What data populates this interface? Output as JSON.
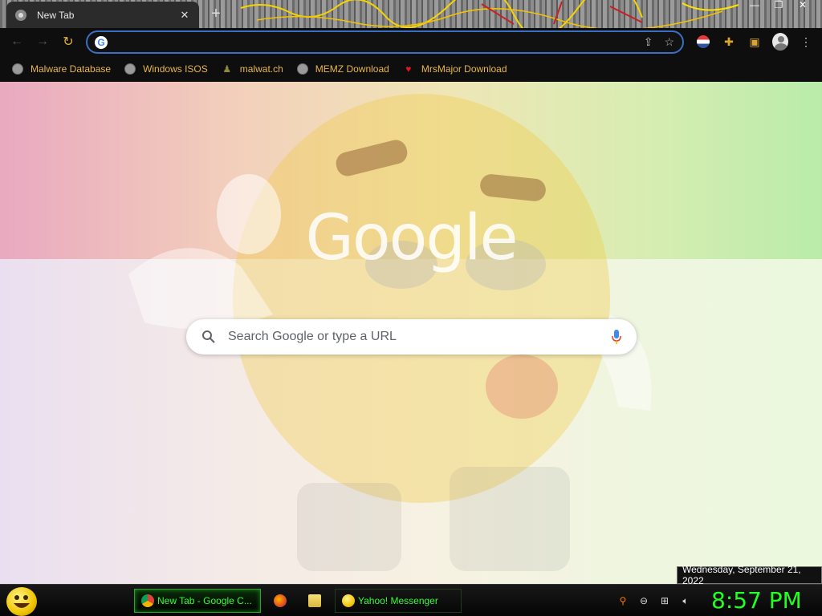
{
  "browser": {
    "tab": {
      "title": "New Tab",
      "close_glyph": "✕"
    },
    "new_tab_glyph": "+",
    "window_controls": [
      "—",
      "❐",
      "✕"
    ],
    "omnibox": {
      "value": "",
      "placeholder": ""
    }
  },
  "bookmarks": [
    {
      "label": "Malware Database",
      "icon": "globe-icon"
    },
    {
      "label": "Windows ISOS",
      "icon": "globe-icon"
    },
    {
      "label": "malwat.ch",
      "icon": "person-icon"
    },
    {
      "label": "MEMZ Download",
      "icon": "globe-icon"
    },
    {
      "label": "MrsMajor Download",
      "icon": "heart-icon"
    }
  ],
  "ntp": {
    "logo_text": "Google",
    "search_placeholder": "Search Google or type a URL"
  },
  "taskbar": {
    "buttons": [
      {
        "label": "New Tab - Google C...",
        "active": true
      },
      {
        "label": "",
        "active": false
      },
      {
        "label": "",
        "active": false
      },
      {
        "label": "Yahoo! Messenger",
        "active": false
      }
    ],
    "clock": "8:57 PM",
    "date_tooltip": "Wednesday, September 21, 2022"
  },
  "colors": {
    "bookmark_text": "#e7b64b",
    "clock": "#22ff22",
    "omnibox_border": "#3b6fc3",
    "toolbar_icons": "#d9a62e"
  }
}
